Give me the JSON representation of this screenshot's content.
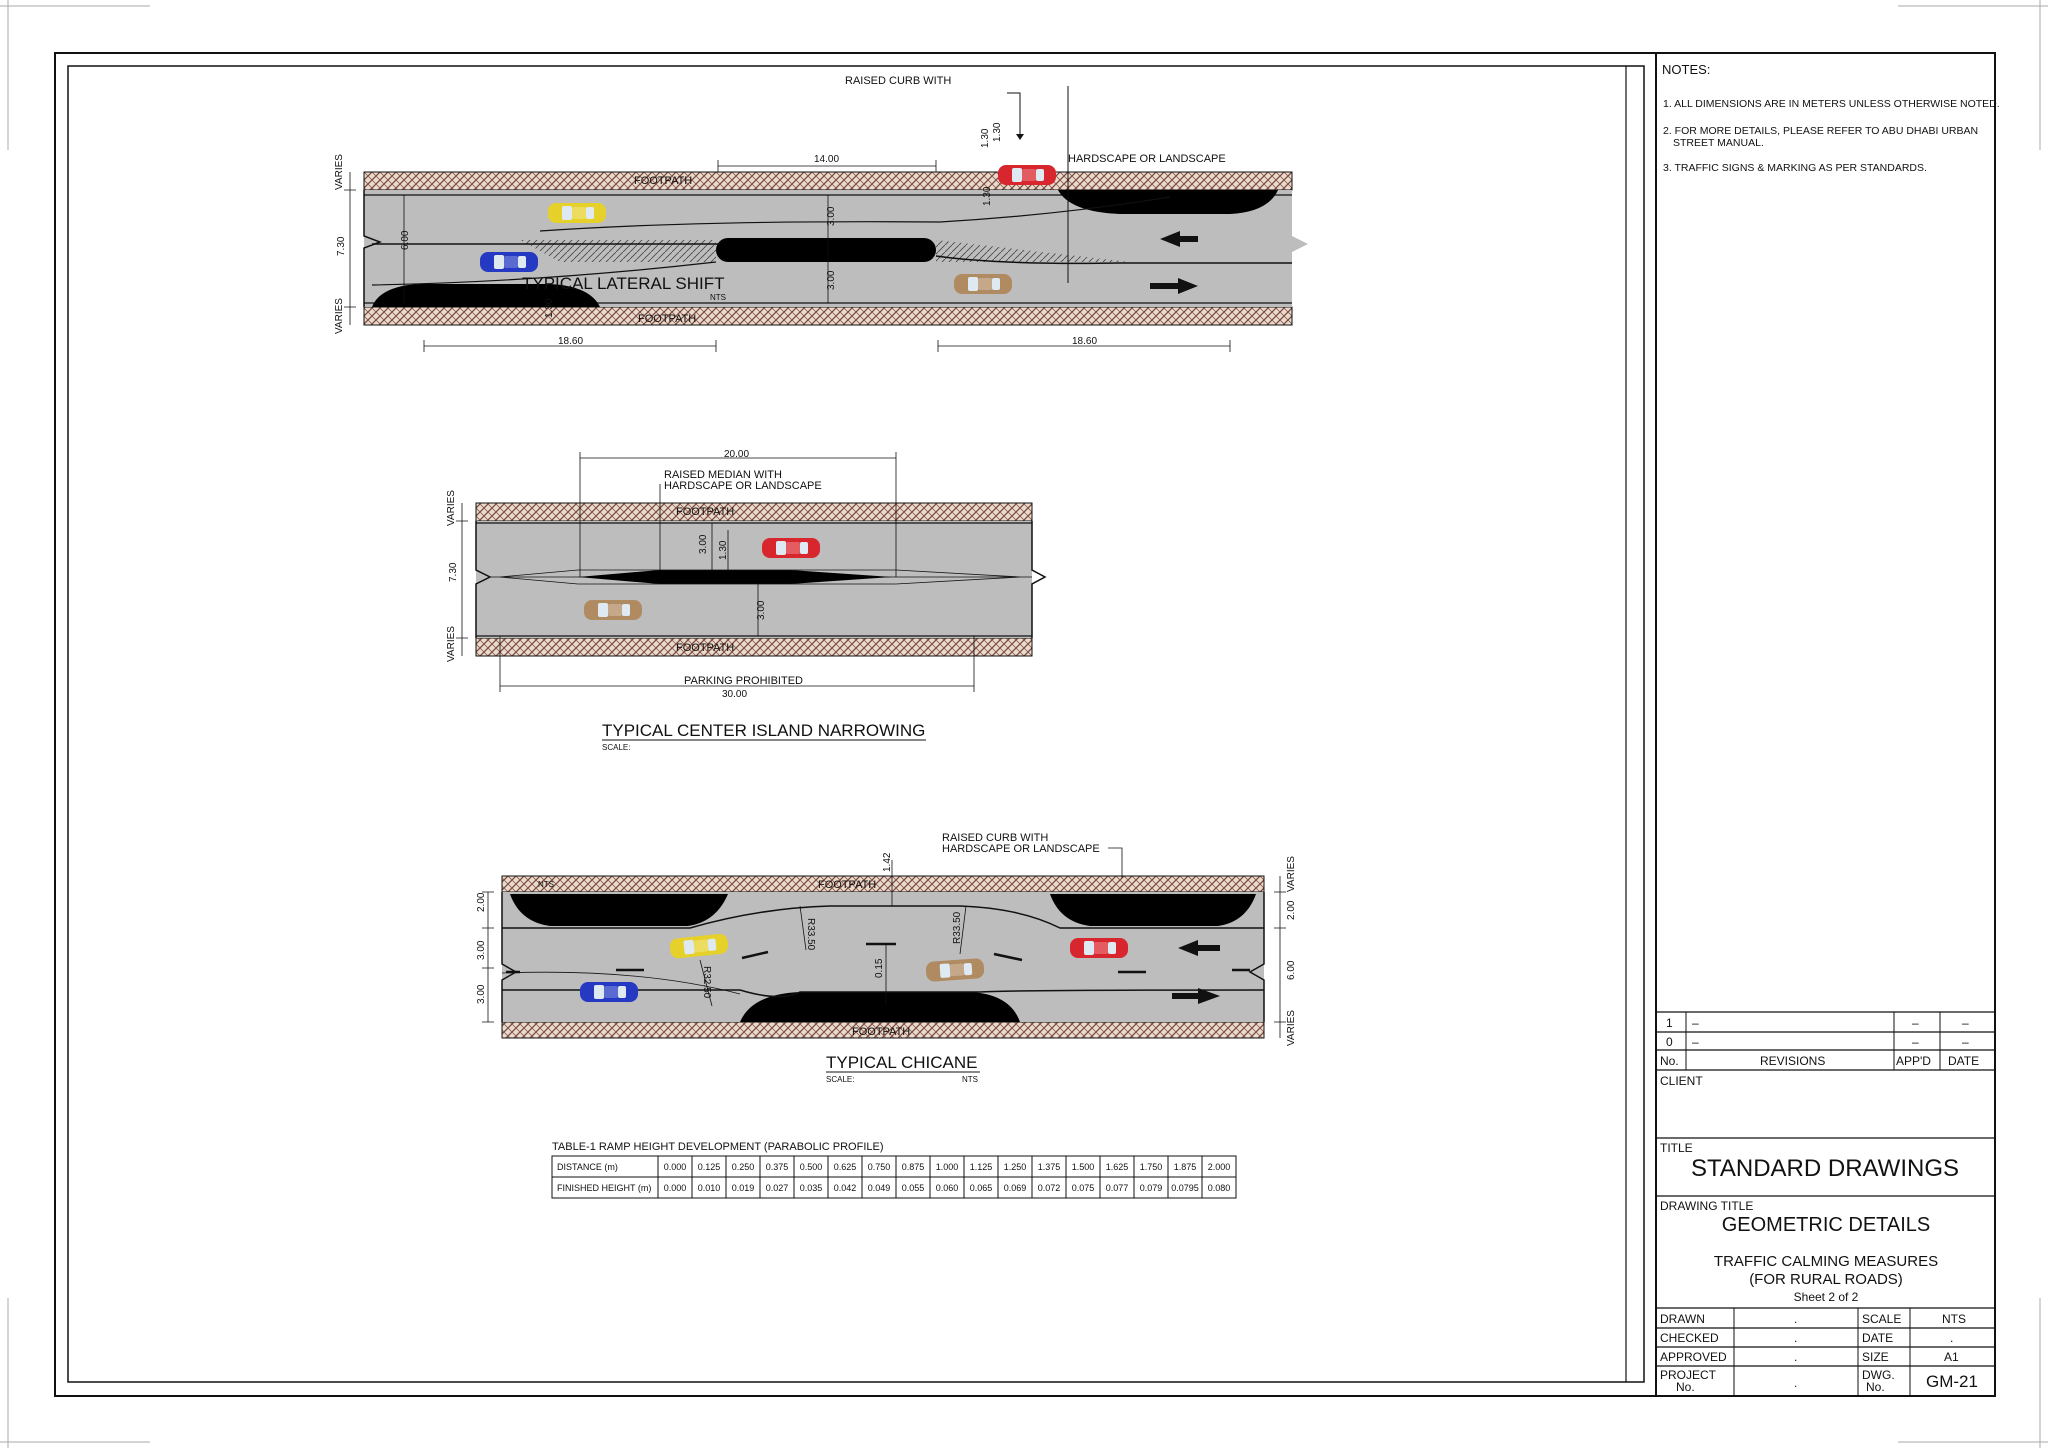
{
  "notes": {
    "heading": "NOTES:",
    "items": [
      "1. ALL DIMENSIONS ARE IN METERS UNLESS OTHERWISE NOTED.",
      "2. FOR MORE DETAILS, PLEASE REFER TO ABU DHABI URBAN",
      "STREET MANUAL.",
      "3. TRAFFIC SIGNS & MARKING AS PER STANDARDS."
    ]
  },
  "lateral_shift": {
    "title": "TYPICAL LATERAL SHIFT",
    "scale": "NTS",
    "callout_top": "RAISED CURB WITH",
    "callout_right": "HARDSCAPE OR LANDSCAPE",
    "footpath": "FOOTPATH",
    "dims": {
      "top_len": "14.00",
      "bottom_left": "18.60",
      "bottom_right": "18.60",
      "road_width": "7.30",
      "varies": "VARIES",
      "lane_a": "3.00",
      "lane_b": "3.00",
      "left_lane": "6.00",
      "curb_a": "1.30",
      "curb_b": "1.30",
      "bay": "1.30",
      "short": "1.30"
    }
  },
  "center_island": {
    "title": "TYPICAL CENTER ISLAND NARROWING",
    "scale_label": "SCALE:",
    "callout": [
      "RAISED MEDIAN WITH",
      "HARDSCAPE OR LANDSCAPE"
    ],
    "footpath": "FOOTPATH",
    "parking": "PARKING PROHIBITED",
    "dims": {
      "top_len": "20.00",
      "total_len": "30.00",
      "road_width": "7.30",
      "varies": "VARIES",
      "lane_a": "3.00",
      "island": "1.30",
      "lane_b": "3.00"
    }
  },
  "chicane": {
    "title": "TYPICAL CHICANE",
    "scale_label": "SCALE:",
    "scale_value": "NTS",
    "nts_mark": "NTS",
    "callout": [
      "RAISED CURB WITH",
      "HARDSCAPE OR LANDSCAPE"
    ],
    "footpath": "FOOTPATH",
    "dims": {
      "left_a": "2.00",
      "left_b": "3.00",
      "left_c": "3.00",
      "right_a": "2.00",
      "right_b": "6.00",
      "varies": "VARIES",
      "r1": "R33.50",
      "r2": "R33.50",
      "r3": "R32.50",
      "gap": "0.15",
      "bump": "1.42"
    }
  },
  "table": {
    "title": "TABLE-1 RAMP HEIGHT DEVELOPMENT (PARABOLIC PROFILE)",
    "rows": [
      {
        "label": "DISTANCE (m)",
        "values": [
          "0.000",
          "0.125",
          "0.250",
          "0.375",
          "0.500",
          "0.625",
          "0.750",
          "0.875",
          "1.000",
          "1.125",
          "1.250",
          "1.375",
          "1.500",
          "1.625",
          "1.750",
          "1.875",
          "2.000"
        ]
      },
      {
        "label": "FINISHED HEIGHT (m)",
        "values": [
          "0.000",
          "0.010",
          "0.019",
          "0.027",
          "0.035",
          "0.042",
          "0.049",
          "0.055",
          "0.060",
          "0.065",
          "0.069",
          "0.072",
          "0.075",
          "0.077",
          "0.079",
          "0.0795",
          "0.080"
        ]
      }
    ]
  },
  "title_block": {
    "revisions": [
      {
        "no": "1",
        "desc": "–",
        "appd": "–",
        "date": "–"
      },
      {
        "no": "0",
        "desc": "–",
        "appd": "–",
        "date": "–"
      }
    ],
    "rev_headers": {
      "no": "No.",
      "revisions": "REVISIONS",
      "appd": "APP'D",
      "date": "DATE"
    },
    "client_label": "CLIENT",
    "title_label": "TITLE",
    "title": "STANDARD DRAWINGS",
    "drawing_title_label": "DRAWING TITLE",
    "drawing_title": "GEOMETRIC DETAILS",
    "subtitle_1": "TRAFFIC CALMING MEASURES",
    "subtitle_2": "(FOR RURAL ROADS)",
    "sheet": "Sheet 2 of 2",
    "drawn_label": "DRAWN",
    "drawn": ".",
    "checked_label": "CHECKED",
    "checked": ".",
    "approved_label": "APPROVED",
    "approved": ".",
    "project_label_1": "PROJECT",
    "project_label_2": "No.",
    "project": ".",
    "scale_label": "SCALE",
    "scale": "NTS",
    "date_label": "DATE",
    "date": ".",
    "size_label": "SIZE",
    "size": "A1",
    "dwg_label_1": "DWG.",
    "dwg_label_2": "No.",
    "dwg_no": "GM-21"
  }
}
